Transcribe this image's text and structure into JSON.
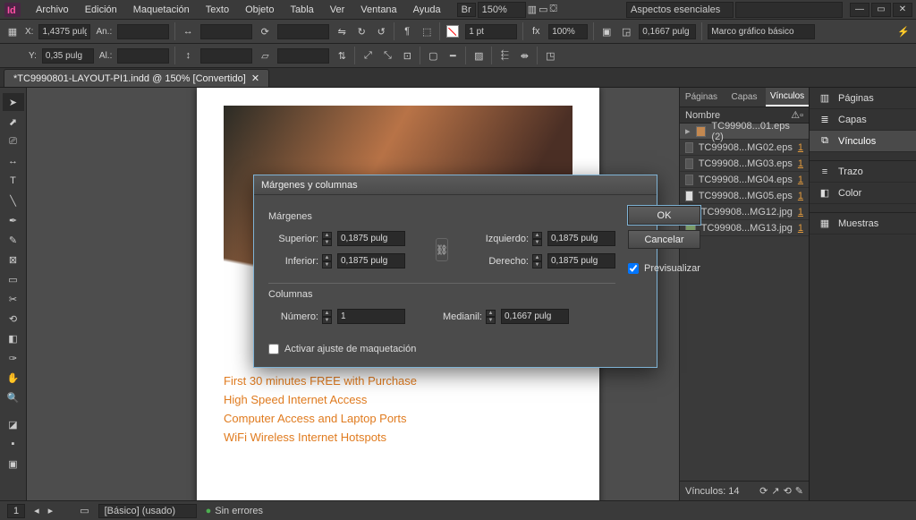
{
  "app": {
    "name": "Id"
  },
  "menu": {
    "items": [
      "Archivo",
      "Edición",
      "Maquetación",
      "Texto",
      "Objeto",
      "Tabla",
      "Ver",
      "Ventana",
      "Ayuda"
    ]
  },
  "topbar": {
    "br": "Br",
    "zoom": "150%",
    "workspace": "Aspectos esenciales",
    "search_placeholder": ""
  },
  "control1": {
    "x": "1,4375 pulg",
    "y": "0,35 pulg",
    "w": "",
    "h": ""
  },
  "control2": {
    "stroke": "1 pt",
    "opacity": "100%",
    "basic": "0,1667 pulg",
    "style": "Marco gráfico básico"
  },
  "doc": {
    "title": "*TC9990801-LAYOUT-PI1.indd @ 150% [Convertido]"
  },
  "page_lines": [
    "First 30 minutes FREE with Purchase",
    "High Speed Internet Access",
    "Computer Access and Laptop Ports",
    "WiFi Wireless Internet Hotspots"
  ],
  "links_panel": {
    "tabs": [
      "Páginas",
      "Capas",
      "Vínculos"
    ],
    "active_tab": 2,
    "header": "Nombre",
    "rows": [
      {
        "name": "TC99908...01.eps (2)",
        "page": ""
      },
      {
        "name": "TC99908...MG02.eps",
        "page": "1"
      },
      {
        "name": "TC99908...MG03.eps",
        "page": "1"
      },
      {
        "name": "TC99908...MG04.eps",
        "page": "1"
      },
      {
        "name": "TC99908...MG05.eps",
        "page": "1"
      },
      {
        "name": "TC99908...MG12.jpg",
        "page": "1"
      },
      {
        "name": "TC99908...MG13.jpg",
        "page": "1"
      }
    ],
    "footer": "Vínculos: 14"
  },
  "dock": {
    "items": [
      "Páginas",
      "Capas",
      "Vínculos",
      "Trazo",
      "Color",
      "Muestras"
    ],
    "active": 2
  },
  "dialog": {
    "title": "Márgenes y columnas",
    "margins_label": "Márgenes",
    "columns_label": "Columnas",
    "labels": {
      "top": "Superior:",
      "bottom": "Inferior:",
      "left": "Izquierdo:",
      "right": "Derecho:",
      "number": "Número:",
      "gutter": "Medianil:"
    },
    "values": {
      "top": "0,1875 pulg",
      "bottom": "0,1875 pulg",
      "left": "0,1875 pulg",
      "right": "0,1875 pulg",
      "number": "1",
      "gutter": "0,1667 pulg"
    },
    "ok": "OK",
    "cancel": "Cancelar",
    "preview": "Previsualizar",
    "layout_adjust": "Activar ajuste de maquetación"
  },
  "status": {
    "page": "1",
    "style": "[Básico] (usado)",
    "errors": "Sin errores"
  }
}
